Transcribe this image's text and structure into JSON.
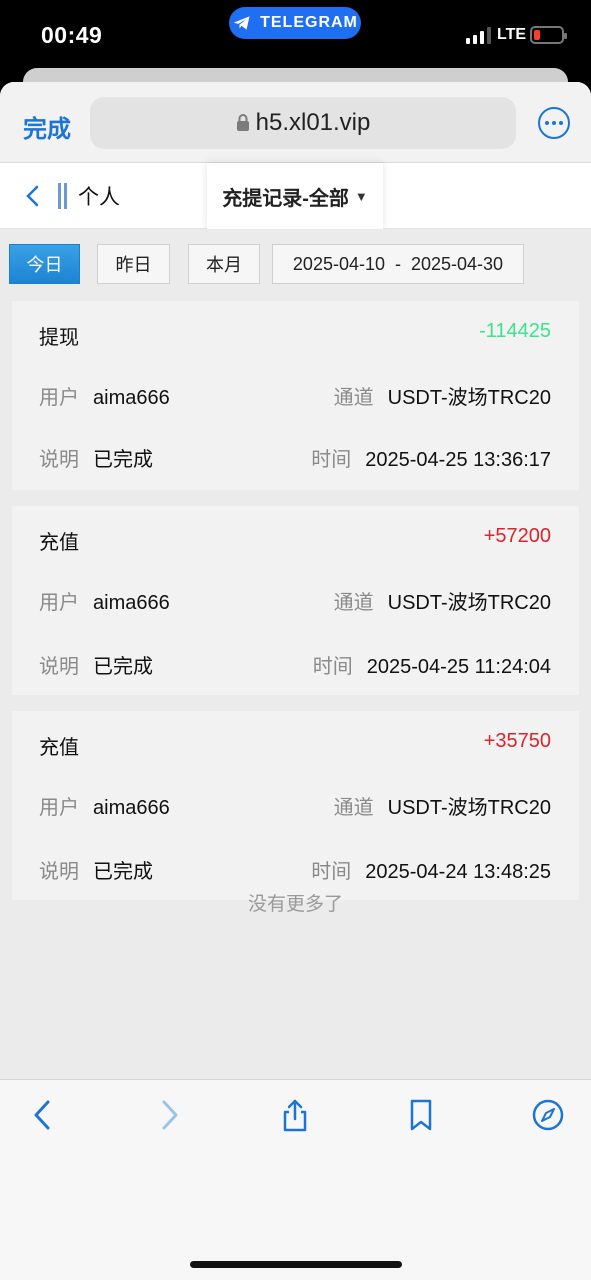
{
  "status_bar": {
    "time": "00:49",
    "telegram_label": "TELEGRAM",
    "network": "LTE",
    "battery_color": "#ff3b30"
  },
  "browser": {
    "done_label": "完成",
    "url": "h5.xl01.vip",
    "accent_color": "#1c75d4"
  },
  "header": {
    "personal_label": "个人",
    "title": "充提记录-全部",
    "caret": "▼"
  },
  "filters": {
    "today": "今日",
    "yesterday": "昨日",
    "this_month": "本月",
    "date_range": "2025-04-10  -  2025-04-30"
  },
  "labels": {
    "user": "用户",
    "channel": "通道",
    "note": "说明",
    "time": "时间"
  },
  "records": [
    {
      "type": "提现",
      "amount": "-114425",
      "user": "aima666",
      "channel": "USDT-波场TRC20",
      "note": "已完成",
      "time": "2025-04-25 13:36:17"
    },
    {
      "type": "充值",
      "amount": "+57200",
      "user": "aima666",
      "channel": "USDT-波场TRC20",
      "note": "已完成",
      "time": "2025-04-25 11:24:04"
    },
    {
      "type": "充值",
      "amount": "+35750",
      "user": "aima666",
      "channel": "USDT-波场TRC20",
      "note": "已完成",
      "time": "2025-04-24 13:48:25"
    }
  ],
  "no_more_text": "没有更多了",
  "colors": {
    "negative_amount": "#3be38e",
    "positive_amount": "#d9252b",
    "active_filter": "#1c84d2"
  }
}
